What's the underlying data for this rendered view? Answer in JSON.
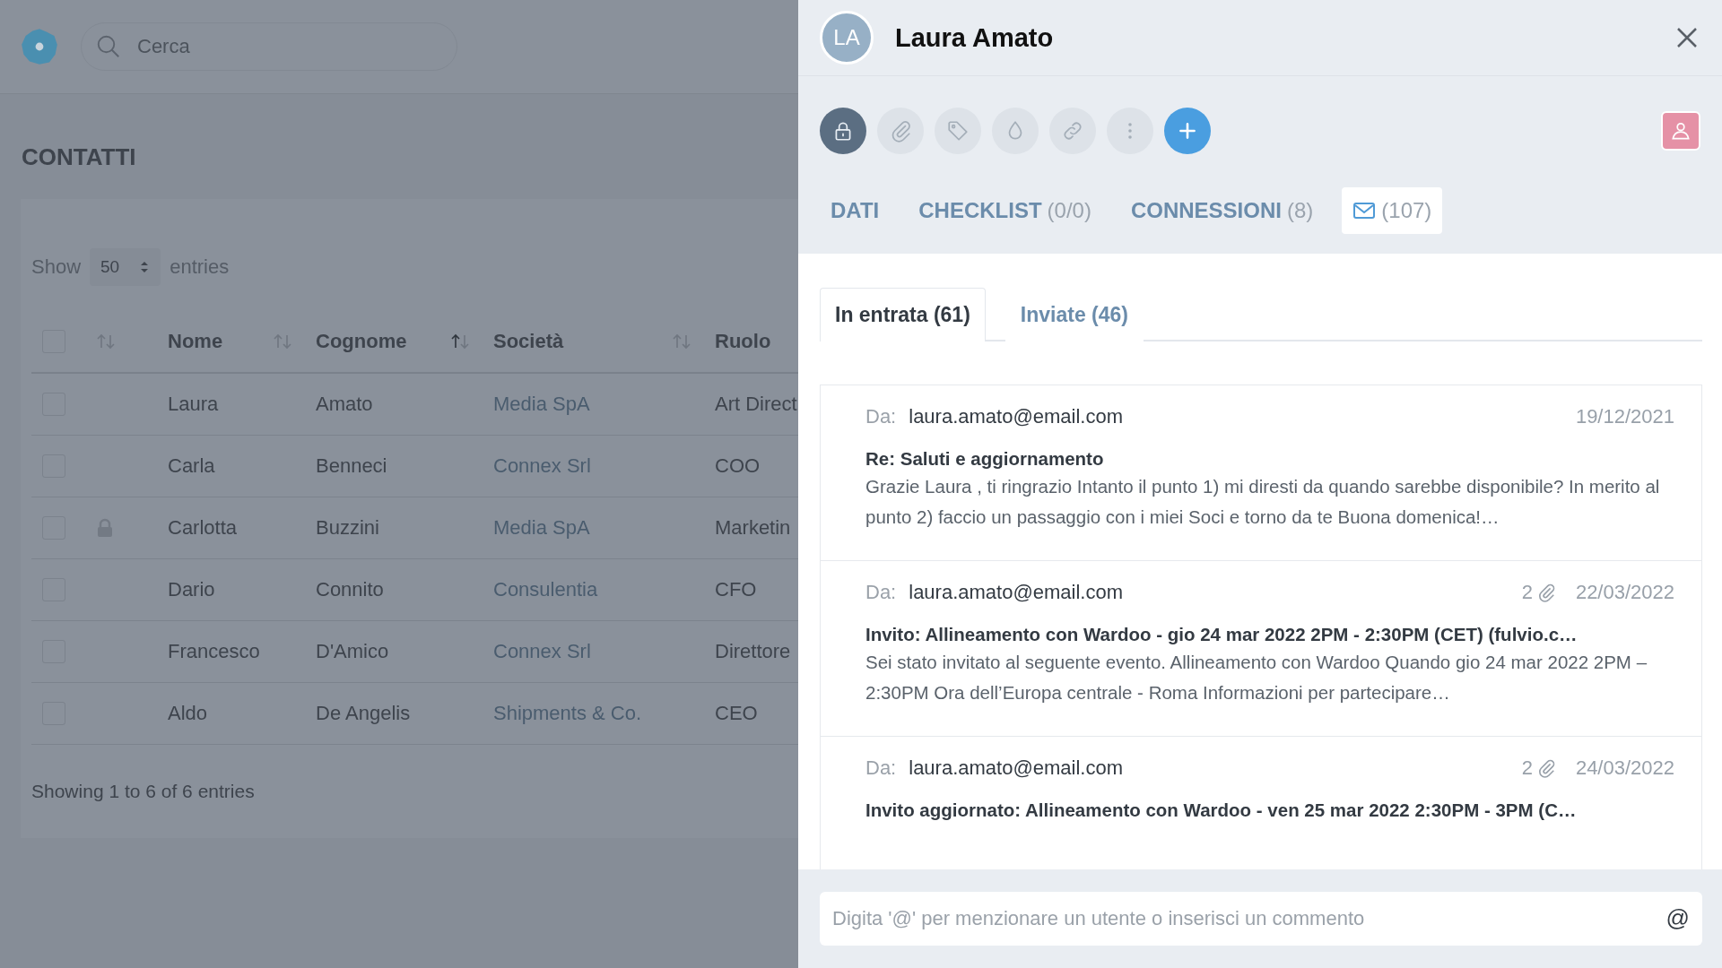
{
  "app": {
    "search": {
      "placeholder": "Cerca"
    },
    "page_title": "CONTATTI"
  },
  "table": {
    "length": {
      "label_before": "Show",
      "value": "50",
      "label_after": "entries"
    },
    "header_checkbox": {
      "checked": false
    },
    "lock_column": {
      "sorted": false
    },
    "columns": [
      {
        "label": "Nome",
        "sorted": false
      },
      {
        "label": "Cognome",
        "sorted": true
      },
      {
        "label": "Società",
        "sorted": false
      },
      {
        "label": "Ruolo"
      }
    ],
    "rows": [
      {
        "checked": false,
        "locked": false,
        "nome": "Laura",
        "cognome": "Amato",
        "societa": "Media SpA",
        "ruolo": "Art Direct"
      },
      {
        "checked": false,
        "locked": false,
        "nome": "Carla",
        "cognome": "Benneci",
        "societa": "Connex Srl",
        "ruolo": "COO"
      },
      {
        "checked": false,
        "locked": true,
        "nome": "Carlotta",
        "cognome": "Buzzini",
        "societa": "Media SpA",
        "ruolo": "Marketin"
      },
      {
        "checked": false,
        "locked": false,
        "nome": "Dario",
        "cognome": "Connito",
        "societa": "Consulentia",
        "ruolo": "CFO"
      },
      {
        "checked": false,
        "locked": false,
        "nome": "Francesco",
        "cognome": "D'Amico",
        "societa": "Connex Srl",
        "ruolo": "Direttore"
      },
      {
        "checked": false,
        "locked": false,
        "nome": "Aldo",
        "cognome": "De Angelis",
        "societa": "Shipments & Co.",
        "ruolo": "CEO"
      }
    ],
    "info": "Showing 1 to 6 of 6 entries"
  },
  "panel": {
    "avatar_initials": "LA",
    "name": "Laura Amato",
    "actions": [
      {
        "kind": "lock"
      },
      {
        "kind": "attachment"
      },
      {
        "kind": "tag"
      },
      {
        "kind": "drop"
      },
      {
        "kind": "link"
      },
      {
        "kind": "more"
      },
      {
        "kind": "add"
      }
    ],
    "tabs": [
      {
        "kind": "text",
        "label": "DATI",
        "selected": false
      },
      {
        "kind": "text",
        "label": "CHECKLIST",
        "count": "(0/0)",
        "selected": false
      },
      {
        "kind": "text",
        "label": "CONNESSIONI",
        "count": "(8)",
        "selected": false
      },
      {
        "kind": "mail",
        "count": "(107)",
        "selected": true
      }
    ],
    "mail_tabs": [
      {
        "label": "In entrata (61)",
        "selected": true
      },
      {
        "label": "Inviate (46)",
        "selected": false
      }
    ],
    "emails": [
      {
        "from_label": "Da:",
        "from": "laura.amato@email.com",
        "date": "19/12/2021",
        "subject": "Re: Saluti e aggiornamento",
        "preview": "Grazie Laura , ti ringrazio Intanto il punto 1) mi diresti da quando sarebbe disponibile? In merito al punto 2) faccio un passaggio con i miei Soci e torno da te Buona domenica!…"
      },
      {
        "from_label": "Da:",
        "from": "laura.amato@email.com",
        "attachments": "2",
        "date": "22/03/2022",
        "subject": "Invito: Allineamento con Wardoo - gio 24 mar 2022 2PM - 2:30PM (CET) (fulvio.c…",
        "preview": "Sei stato invitato al seguente evento. Allineamento con Wardoo  Quando gio 24 mar 2022 2PM – 2:30PM Ora dell’Europa centrale - Roma Informazioni per partecipare…"
      },
      {
        "from_label": "Da:",
        "from": "laura.amato@email.com",
        "attachments": "2",
        "date": "24/03/2022",
        "subject": "Invito aggiornato: Allineamento con Wardoo - ven 25 mar 2022 2:30PM - 3PM (C…"
      }
    ],
    "comment": {
      "placeholder": "Digita '@' per menzionare un utente o inserisci un commento",
      "mention_symbol": "@"
    }
  }
}
